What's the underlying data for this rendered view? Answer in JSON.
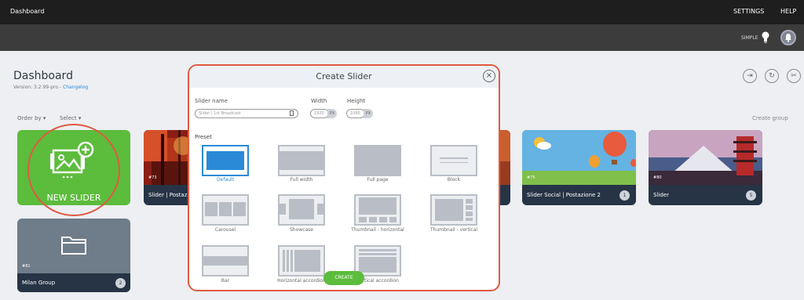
{
  "topbar": {
    "brand": "Dashboard",
    "settings": "SETTINGS",
    "help": "HELP"
  },
  "subbar": {
    "mode": "SIMPLE"
  },
  "dashboard": {
    "title": "Dashboard",
    "version": "Version: 3.2.99-pro -",
    "changelog": "Changelog"
  },
  "filters": {
    "order_by": "Order by ▾",
    "select": "Select ▾",
    "create_group": "Create group"
  },
  "new_slider": {
    "label": "NEW SLIDER"
  },
  "group": {
    "badge": "#81",
    "name": "Milan Group",
    "count": "2"
  },
  "cards": [
    {
      "num": "#73",
      "name": "Slider | Postazio",
      "count": ""
    },
    {
      "num": "#75",
      "name": "Slider Social | Postazione 2",
      "count": "1"
    },
    {
      "num": "#80",
      "name": "Slider",
      "count": "5"
    }
  ],
  "modal": {
    "title": "Create Slider",
    "name_label": "Slider name",
    "name_value": "Slider | 1st Broadcast",
    "width_label": "Width",
    "width_value": "1920",
    "height_label": "Height",
    "height_value": "1080",
    "unit": "PX",
    "preset_label": "Preset",
    "presets": [
      {
        "label": "Default"
      },
      {
        "label": "Full width"
      },
      {
        "label": "Full page"
      },
      {
        "label": "Block"
      },
      {
        "label": "Carousel"
      },
      {
        "label": "Showcase"
      },
      {
        "label": "Thumbnail - horizontal"
      },
      {
        "label": "Thumbnail - vertical"
      },
      {
        "label": "Bar"
      },
      {
        "label": "Horizontal accordion"
      },
      {
        "label": "Vertical accordion"
      }
    ],
    "create_label": "CREATE"
  }
}
